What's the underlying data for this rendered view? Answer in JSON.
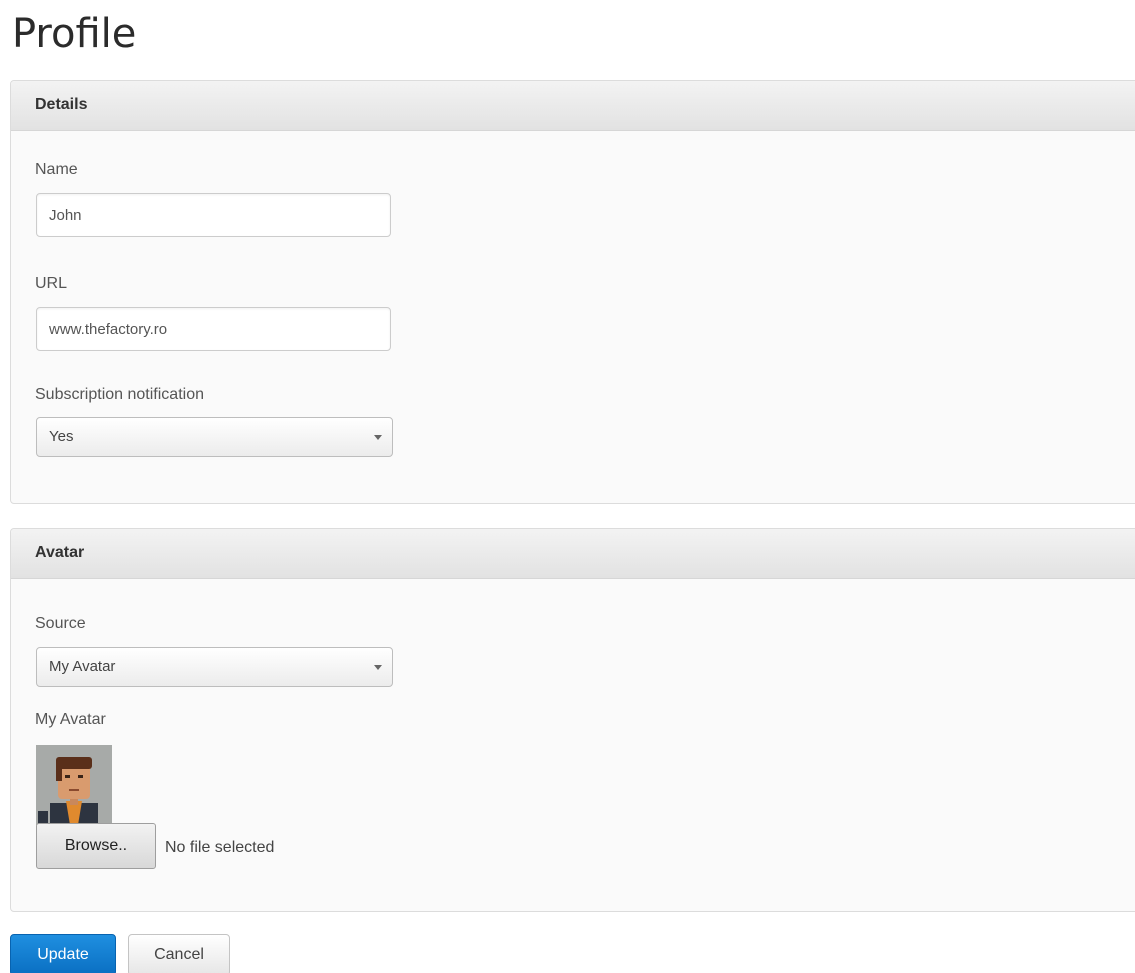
{
  "page": {
    "title": "Profile"
  },
  "details": {
    "header": "Details",
    "name_label": "Name",
    "name_value": "John",
    "url_label": "URL",
    "url_value": "www.thefactory.ro",
    "subscription_label": "Subscription notification",
    "subscription_value": "Yes"
  },
  "avatar": {
    "header": "Avatar",
    "source_label": "Source",
    "source_value": "My Avatar",
    "my_avatar_label": "My Avatar",
    "browse_label": "Browse..",
    "file_status": "No file selected"
  },
  "actions": {
    "update_label": "Update",
    "cancel_label": "Cancel"
  },
  "colors": {
    "primary_button": "#0a7fd4",
    "panel_header": "#e6e6e6"
  },
  "icons": {
    "select_caret": "caret-down-icon"
  }
}
